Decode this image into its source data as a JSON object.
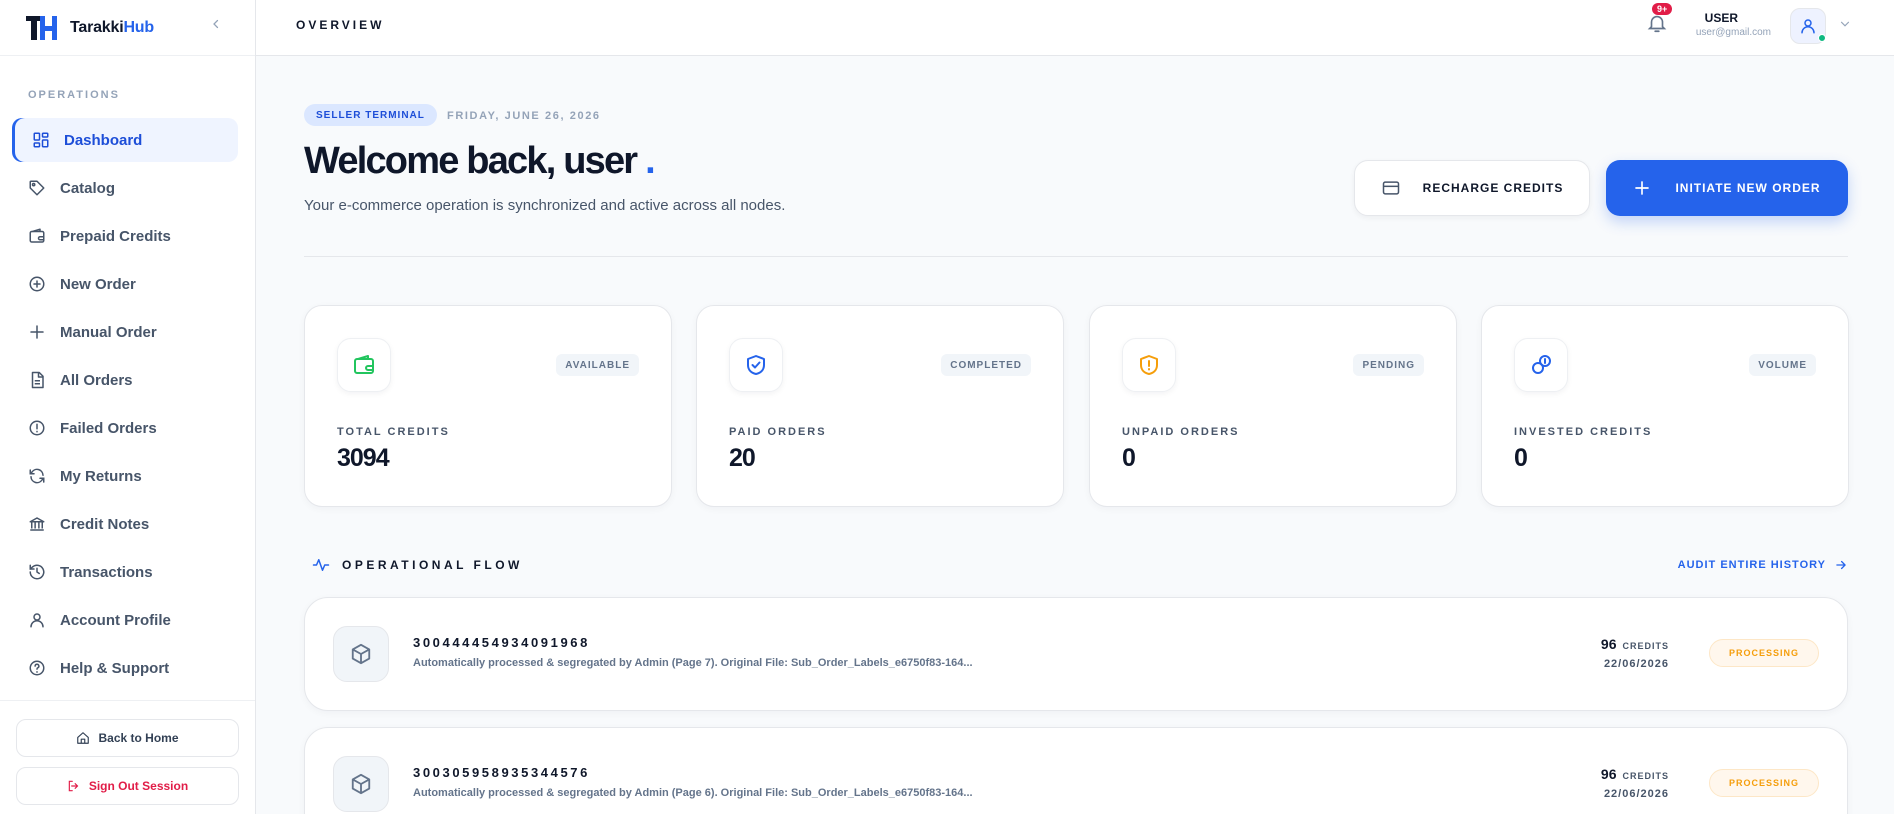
{
  "brand": {
    "logo_text": "TH",
    "name_part1": "Tarakki",
    "name_part2": "Hub"
  },
  "sidebar": {
    "section_label": "OPERATIONS",
    "items": [
      {
        "label": "Dashboard",
        "icon": "dashboard-icon",
        "active": true
      },
      {
        "label": "Catalog",
        "icon": "tag-icon"
      },
      {
        "label": "Prepaid Credits",
        "icon": "wallet-icon"
      },
      {
        "label": "New Order",
        "icon": "plus-circle-icon"
      },
      {
        "label": "Manual Order",
        "icon": "plus-icon"
      },
      {
        "label": "All Orders",
        "icon": "document-icon"
      },
      {
        "label": "Failed Orders",
        "icon": "alert-circle-icon"
      },
      {
        "label": "My Returns",
        "icon": "refresh-icon"
      },
      {
        "label": "Credit Notes",
        "icon": "bank-icon"
      },
      {
        "label": "Transactions",
        "icon": "history-icon"
      },
      {
        "label": "Account Profile",
        "icon": "user-icon"
      },
      {
        "label": "Help & Support",
        "icon": "help-circle-icon"
      }
    ],
    "back_home": "Back to Home",
    "sign_out": "Sign Out Session"
  },
  "topbar": {
    "title": "OVERVIEW",
    "notification_count": "9+",
    "user_name": "USER",
    "user_email": "user@gmail.com"
  },
  "hero": {
    "badge": "SELLER TERMINAL",
    "date": "FRIDAY, JUNE 26, 2026",
    "welcome": "Welcome back, user",
    "welcome_dot": ".",
    "subtitle": "Your e-commerce operation is synchronized and active across all nodes.",
    "recharge_label": "RECHARGE CREDITS",
    "new_order_label": "INITIATE NEW ORDER"
  },
  "stats": [
    {
      "tag": "AVAILABLE",
      "label": "TOTAL CREDITS",
      "value": "3094",
      "icon": "wallet-icon",
      "color": "#22c55e"
    },
    {
      "tag": "COMPLETED",
      "label": "PAID ORDERS",
      "value": "20",
      "icon": "shield-check-icon",
      "color": "#2563eb"
    },
    {
      "tag": "PENDING",
      "label": "UNPAID ORDERS",
      "value": "0",
      "icon": "shield-alert-icon",
      "color": "#f59e0b"
    },
    {
      "tag": "VOLUME",
      "label": "INVESTED CREDITS",
      "value": "0",
      "icon": "coins-icon",
      "color": "#2563eb"
    }
  ],
  "flow": {
    "title": "OPERATIONAL FLOW",
    "audit_label": "AUDIT ENTIRE HISTORY",
    "orders": [
      {
        "id": "300444454934091968",
        "description": "Automatically processed & segregated by Admin (Page 7). Original File: Sub_Order_Labels_e6750f83-164...",
        "credits": "96",
        "credits_label": "CREDITS",
        "date": "22/06/2026",
        "status": "PROCESSING"
      },
      {
        "id": "300305958935344576",
        "description": "Automatically processed & segregated by Admin (Page 6). Original File: Sub_Order_Labels_e6750f83-164...",
        "credits": "96",
        "credits_label": "CREDITS",
        "date": "22/06/2026",
        "status": "PROCESSING"
      }
    ]
  },
  "colors": {
    "accent": "#2563eb",
    "danger": "#e11d48",
    "warning": "#f59e0b",
    "success": "#22c55e"
  }
}
